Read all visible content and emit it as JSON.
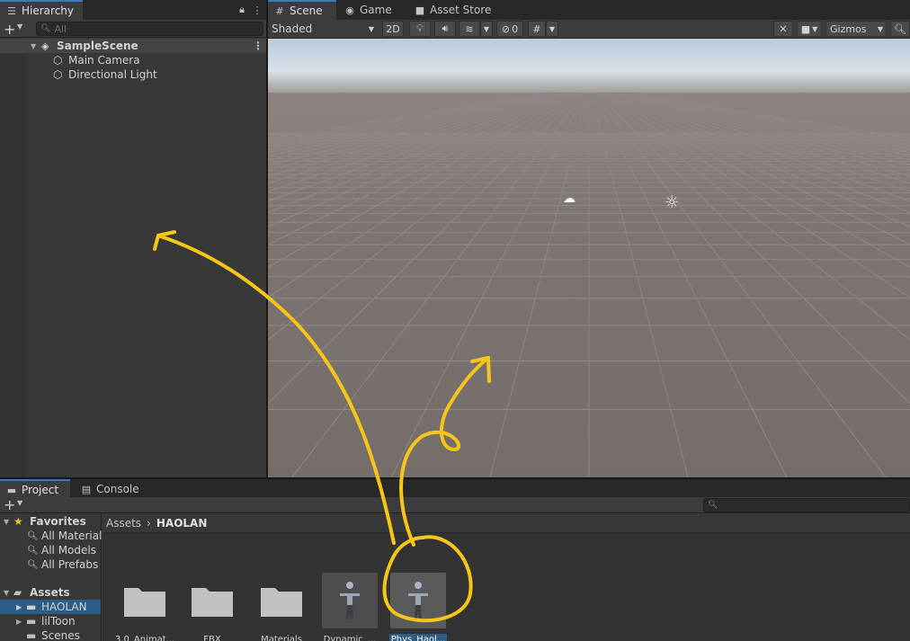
{
  "hierarchy": {
    "tab_label": "Hierarchy",
    "search_placeholder": "All",
    "scene_name": "SampleScene",
    "items": [
      {
        "label": "Main Camera"
      },
      {
        "label": "Directional Light"
      }
    ]
  },
  "scene_view": {
    "tabs": [
      {
        "label": "Scene",
        "icon": "hash-icon"
      },
      {
        "label": "Game",
        "icon": "gamepad-icon"
      },
      {
        "label": "Asset Store",
        "icon": "bag-icon"
      }
    ],
    "shading_mode": "Shaded",
    "mode_2d": "2D",
    "hidden_count": "0",
    "gizmos_label": "Gizmos"
  },
  "project": {
    "tabs": [
      {
        "label": "Project",
        "icon": "folder-icon"
      },
      {
        "label": "Console",
        "icon": "console-icon"
      }
    ],
    "favorites": {
      "label": "Favorites",
      "items": [
        {
          "label": "All Materials"
        },
        {
          "label": "All Models"
        },
        {
          "label": "All Prefabs"
        }
      ]
    },
    "assets_root": {
      "label": "Assets",
      "children": [
        {
          "label": "HAOLAN"
        },
        {
          "label": "lilToon"
        },
        {
          "label": "Scenes"
        }
      ]
    },
    "breadcrumb": {
      "root": "Assets",
      "separator": "›",
      "current": "HAOLAN"
    },
    "assets": [
      {
        "label": "3.0_Animat...",
        "kind": "folder"
      },
      {
        "label": "FBX",
        "kind": "folder"
      },
      {
        "label": "Materials",
        "kind": "folder"
      },
      {
        "label": "Dynamic_...",
        "kind": "prefab"
      },
      {
        "label": "Phys_Haol...",
        "kind": "prefab",
        "selected": true
      }
    ]
  },
  "colors": {
    "accent_blue": "#2c5d87",
    "annotation_yellow": "#f5c518",
    "panel_bg": "#383838",
    "ground": "#7a7370"
  }
}
